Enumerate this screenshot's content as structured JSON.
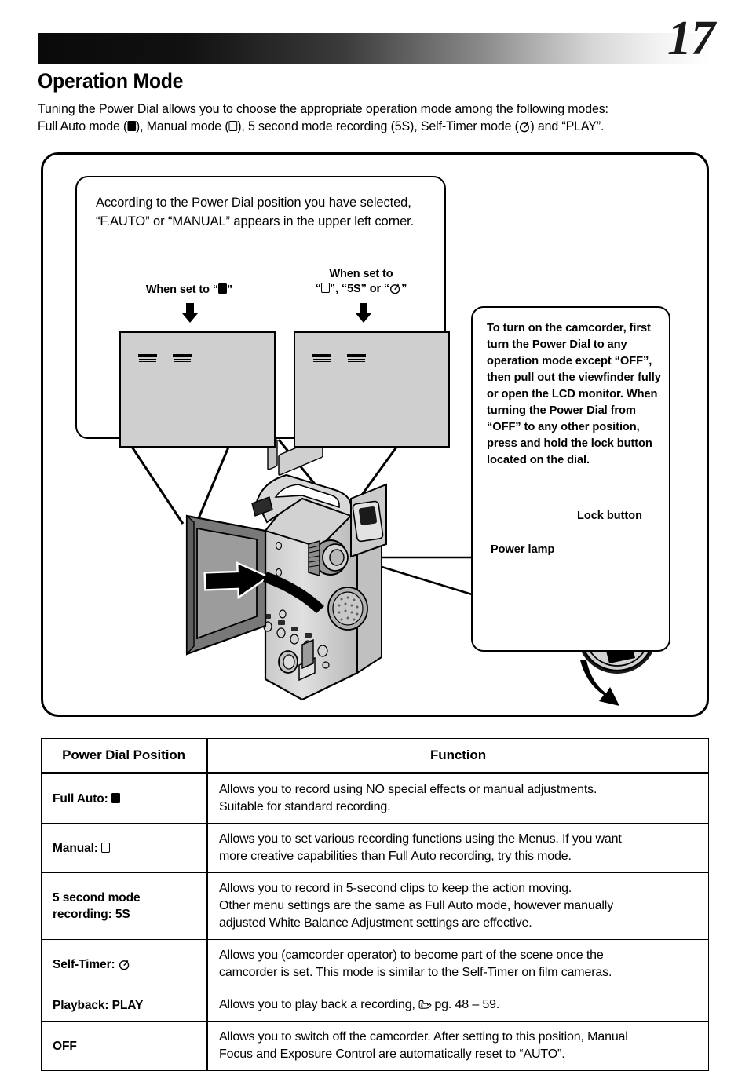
{
  "page": {
    "number": "17",
    "title": "Operation Mode",
    "intro_line1": "Tuning the Power Dial allows you to choose the appropriate operation mode among the following modes:",
    "intro_line2_a": "Full Auto mode (",
    "intro_line2_b": "), Manual mode (",
    "intro_line2_c": "), 5 second mode recording (5S), Self-Timer mode (",
    "intro_line2_d": ") and “PLAY”."
  },
  "illustration": {
    "display_note": "According to the Power Dial position you have selected, “F.AUTO” or “MANUAL” appears in the upper left corner.",
    "when_left_prefix": "When set to “",
    "when_left_suffix": "”",
    "when_right_line1": "When set to",
    "when_right_a": "“",
    "when_right_b": "”, “5S” or “",
    "when_right_c": "”",
    "power_note": "To turn on the camcorder, first turn the Power Dial to any operation mode except “OFF”, then pull out the viewfinder fully or open the LCD monitor. When turning the Power Dial from “OFF” to any other position, press and hold the lock button located on the dial.",
    "lock_button_label": "Lock button",
    "power_lamp_label": "Power lamp",
    "icons": {
      "full_auto": "filled-square-icon",
      "manual": "outline-square-icon",
      "self_timer": "self-timer-clock-icon",
      "down_arrow": "down-arrow-icon",
      "camcorder": "camcorder-illustration",
      "power_dial": "power-dial-illustration",
      "rotate_arrow": "rotate-arrow-icon"
    },
    "colors": {
      "lcd_fill": "#cfcfcf",
      "body_light": "#d9d9d9",
      "body_mid": "#b4b4b4",
      "body_dark": "#7d7d7d",
      "screen_gray": "#9a9a9a"
    }
  },
  "table": {
    "headers": [
      "Power Dial Position",
      "Function"
    ],
    "rows": [
      {
        "position_text": "Full Auto: ",
        "position_icon": "filled-square-icon",
        "function_lines": [
          "Allows you to record using NO special effects or manual adjustments.",
          "Suitable for standard recording."
        ]
      },
      {
        "position_text": "Manual: ",
        "position_icon": "outline-square-icon",
        "function_lines": [
          "Allows you to set various recording functions using the Menus. If you want",
          "more creative capabilities than Full Auto recording, try this mode."
        ]
      },
      {
        "position_text": "5 second mode\nrecording: 5S",
        "position_icon": "",
        "function_lines": [
          "Allows you to record in 5-second clips to keep the action moving.",
          "Other menu settings are the same as Full Auto mode, however manually",
          "adjusted White Balance Adjustment settings are effective."
        ]
      },
      {
        "position_text": "Self-Timer: ",
        "position_icon": "self-timer-clock-icon",
        "function_lines": [
          "Allows you (camcorder operator) to become part of the scene once the",
          "camcorder is set. This mode is similar to the Self-Timer on film cameras."
        ]
      },
      {
        "position_text": "Playback: PLAY",
        "position_icon": "",
        "function_prefix": "Allows you to play back a recording, ",
        "function_icon": "pointing-hand-icon",
        "function_suffix": " pg. 48 – 59."
      },
      {
        "position_text": "OFF",
        "position_icon": "",
        "function_lines": [
          "Allows you to switch off the camcorder. After setting to this position, Manual",
          "Focus and Exposure Control are automatically reset to “AUTO”."
        ]
      }
    ]
  }
}
